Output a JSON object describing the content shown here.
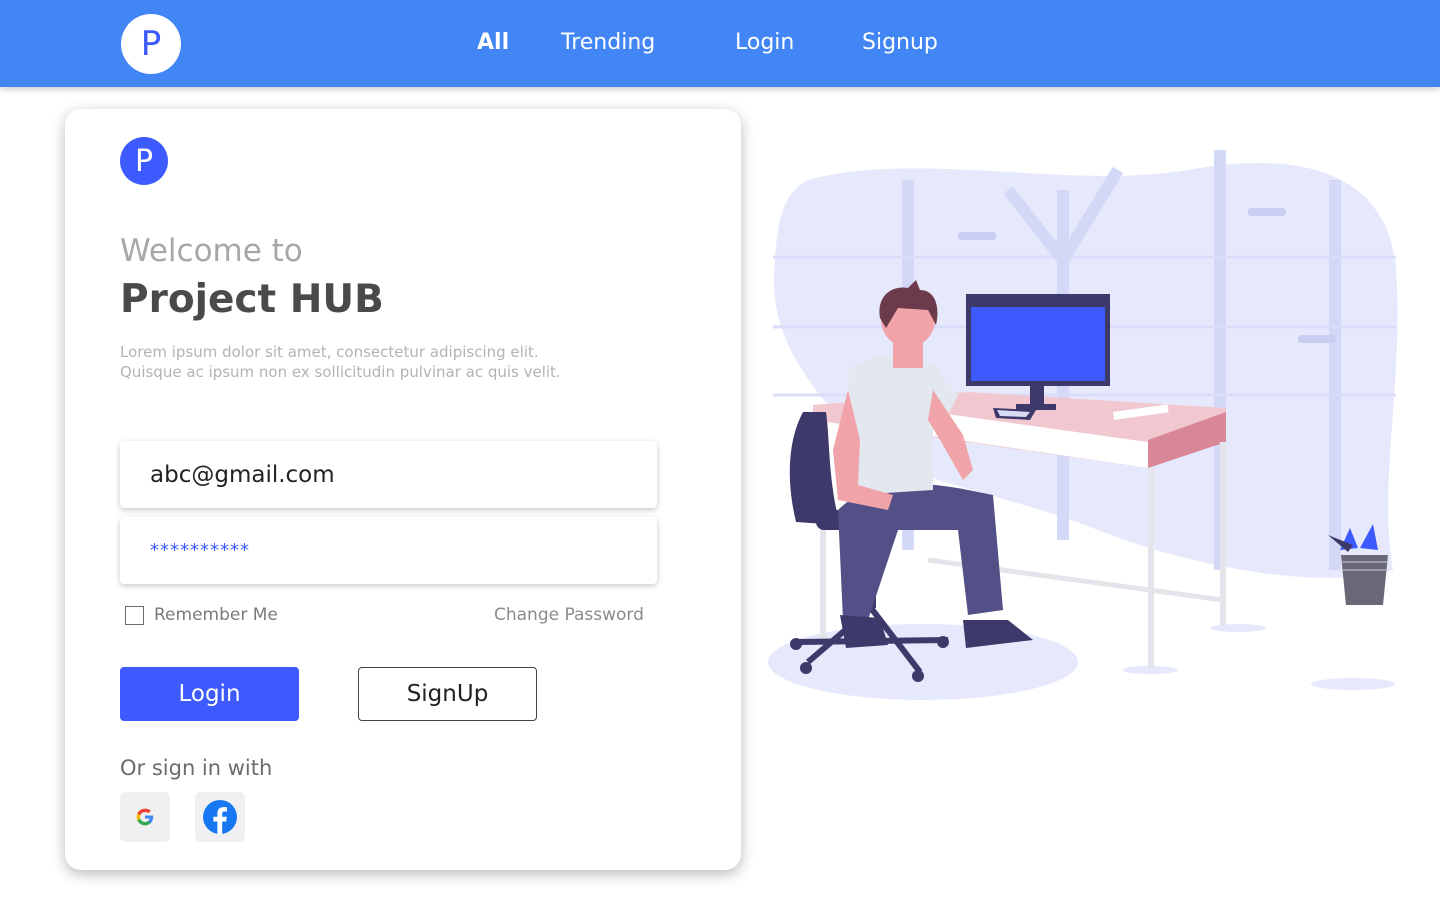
{
  "header": {
    "logo_letter": "P",
    "nav": [
      {
        "label": "All"
      },
      {
        "label": "Trending"
      },
      {
        "label": "Login"
      },
      {
        "label": "Signup"
      }
    ]
  },
  "card": {
    "logo_letter": "P",
    "welcome": "Welcome to",
    "title": "Project HUB",
    "description_lines": [
      "Lorem ipsum dolor sit amet, consectetur adipiscing elit.",
      "Quisque ac ipsum non ex sollicitudin pulvinar ac quis velit."
    ],
    "email_value": "abc@gmail.com",
    "password_value": "**********",
    "remember_label": "Remember Me",
    "remember_checked": false,
    "change_password_label": "Change Password",
    "login_label": "Login",
    "signup_label": "SignUp",
    "or_sign_in": "Or sign in with",
    "social": [
      {
        "icon": "google-icon"
      },
      {
        "icon": "facebook-icon"
      }
    ]
  },
  "colors": {
    "header_bg": "#4285f4",
    "accent": "#3d5afe",
    "desk": "#e3919f",
    "blob": "#e6e9fb"
  }
}
